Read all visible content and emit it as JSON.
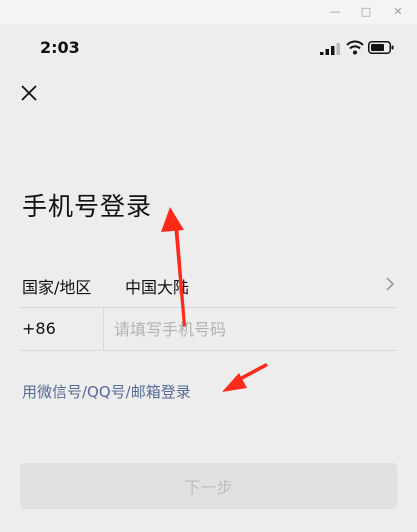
{
  "status": {
    "time": "2:03"
  },
  "page": {
    "title": "手机号登录"
  },
  "region": {
    "label": "国家/地区",
    "value": "中国大陆"
  },
  "phone": {
    "country_code": "+86",
    "placeholder": "请填写手机号码"
  },
  "alt_login": {
    "label": "用微信号/QQ号/邮箱登录"
  },
  "next_button": {
    "label": "下一步"
  },
  "colors": {
    "link": "#576b95",
    "annotation_arrow": "#ff2a1a"
  }
}
